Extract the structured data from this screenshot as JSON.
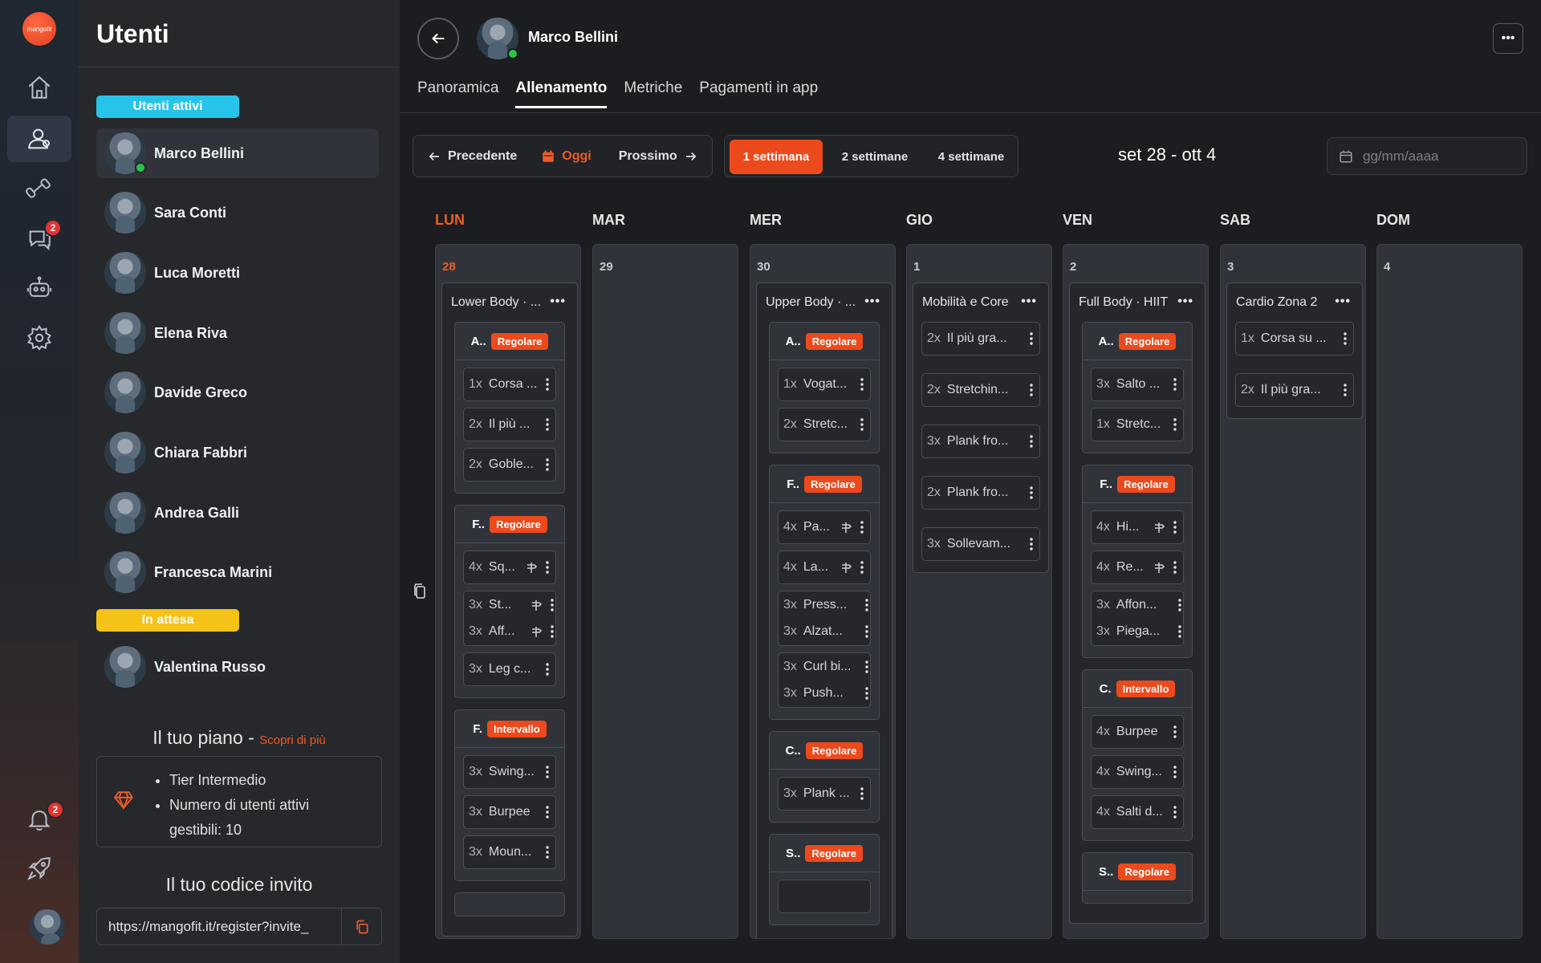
{
  "rail": {
    "logo_text": "mangofit",
    "chat_badge": "2",
    "notifications_badge": "2"
  },
  "users_panel": {
    "title": "Utenti",
    "active_tag": "Utenti attivi",
    "pending_tag": "In attesa",
    "active_users": [
      "Marco Bellini",
      "Sara Conti",
      "Luca Moretti",
      "Elena Riva",
      "Davide Greco",
      "Chiara Fabbri",
      "Andrea Galli",
      "Francesca Marini"
    ],
    "pending_users": [
      "Valentina Russo"
    ],
    "plan_title": "Il tuo piano",
    "plan_sep": " - ",
    "plan_more": "Scopri di più",
    "plan_items": [
      "Tier Intermedio",
      "Numero di utenti attivi gestibili: 10"
    ],
    "invite_title": "Il tuo codice invito",
    "invite_url": "https://mangofit.it/register?invite_"
  },
  "header": {
    "user_name": "Marco Bellini",
    "menu_label": "•••",
    "tabs": [
      "Panoramica",
      "Allenamento",
      "Metriche",
      "Pagamenti in app"
    ],
    "active_tab": 1
  },
  "toolbar": {
    "prev_label": "Precedente",
    "today_label": "Oggi",
    "next_label": "Prossimo",
    "ranges": [
      "1 settimana",
      "2 settimane",
      "4 settimane"
    ],
    "week_title": "set 28 - ott 4",
    "date_placeholder": "gg/mm/aaaa"
  },
  "colors": {
    "accent": "#ec4a1c",
    "active_tag": "#27c4ea",
    "pending_tag": "#f5c218"
  },
  "calendar": {
    "day_labels": [
      "LUN",
      "MAR",
      "MER",
      "GIO",
      "VEN",
      "SAB",
      "DOM"
    ],
    "day_numbers": [
      "28",
      "29",
      "30",
      "1",
      "2",
      "3",
      "4"
    ],
    "mon": {
      "title": "Lower Body · ...",
      "blocks": [
        {
          "letter": "A..",
          "type": "Regolare",
          "ex": [
            [
              "1x",
              "Corsa ..."
            ],
            [
              "2x",
              "Il più ..."
            ],
            [
              "2x",
              "Goble..."
            ]
          ]
        },
        {
          "letter": "F..",
          "type": "Regolare",
          "ex": [
            [
              "4x",
              "Sq..."
            ],
            [
              "3x",
              "St..."
            ],
            [
              "3x",
              "Aff..."
            ],
            [
              "3x",
              "Leg c..."
            ]
          ]
        },
        {
          "letter": "F.",
          "type": "Intervallo",
          "ex": [
            [
              "3x",
              "Swing..."
            ],
            [
              "3x",
              "Burpee"
            ],
            [
              "3x",
              "Moun..."
            ]
          ]
        }
      ]
    },
    "wed": {
      "title": "Upper Body · ...",
      "blocks": [
        {
          "letter": "A..",
          "type": "Regolare",
          "ex": [
            [
              "1x",
              "Vogat..."
            ],
            [
              "2x",
              "Stretc..."
            ]
          ]
        },
        {
          "letter": "F..",
          "type": "Regolare",
          "ex": [
            [
              "4x",
              "Pa..."
            ],
            [
              "4x",
              "La..."
            ],
            [
              "3x",
              "Press..."
            ],
            [
              "3x",
              "Alzat..."
            ],
            [
              "3x",
              "Curl bi..."
            ],
            [
              "3x",
              "Push..."
            ]
          ]
        },
        {
          "letter": "C..",
          "type": "Regolare",
          "ex": [
            [
              "3x",
              "Plank ..."
            ]
          ]
        },
        {
          "letter": "S..",
          "type": "Regolare",
          "ex": []
        }
      ]
    },
    "thu": {
      "title": "Mobilità e Core",
      "ex": [
        [
          "2x",
          "Il più gra..."
        ],
        [
          "2x",
          "Stretchin..."
        ],
        [
          "3x",
          "Plank fro..."
        ],
        [
          "2x",
          "Plank fro..."
        ],
        [
          "3x",
          "Sollevam..."
        ]
      ]
    },
    "fri": {
      "title": "Full Body · HIIT",
      "blocks": [
        {
          "letter": "A..",
          "type": "Regolare",
          "ex": [
            [
              "3x",
              "Salto ..."
            ],
            [
              "1x",
              "Stretc..."
            ]
          ]
        },
        {
          "letter": "F..",
          "type": "Regolare",
          "ex": [
            [
              "4x",
              "Hi..."
            ],
            [
              "4x",
              "Re..."
            ],
            [
              "3x",
              "Affon..."
            ],
            [
              "3x",
              "Piega..."
            ]
          ]
        },
        {
          "letter": "C.",
          "type": "Intervallo",
          "ex": [
            [
              "4x",
              "Burpee"
            ],
            [
              "4x",
              "Swing..."
            ],
            [
              "4x",
              "Salti d..."
            ]
          ]
        },
        {
          "letter": "S..",
          "type": "Regolare",
          "ex": []
        }
      ]
    },
    "sat": {
      "title": "Cardio Zona 2",
      "ex": [
        [
          "1x",
          "Corsa su ..."
        ],
        [
          "2x",
          "Il più gra..."
        ]
      ]
    },
    "workout_menu": "•••"
  }
}
